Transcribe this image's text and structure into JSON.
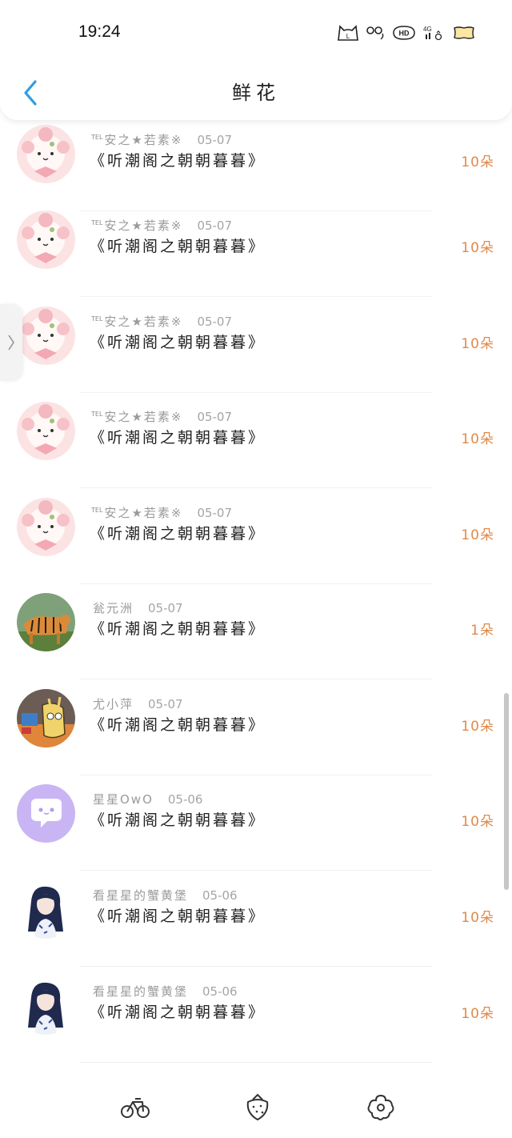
{
  "status_bar": {
    "time": "19:24"
  },
  "header": {
    "title": "鲜花",
    "back_icon": "chevron-left-icon",
    "accent": "#2f9be8"
  },
  "rows": [
    {
      "user": "安之★若素※",
      "tel": "TEL",
      "date": "05-07",
      "title": "《听潮阁之朝朝暮暮》",
      "count": "10朵",
      "avatar": "sheep"
    },
    {
      "user": "安之★若素※",
      "tel": "TEL",
      "date": "05-07",
      "title": "《听潮阁之朝朝暮暮》",
      "count": "10朵",
      "avatar": "sheep"
    },
    {
      "user": "安之★若素※",
      "tel": "TEL",
      "date": "05-07",
      "title": "《听潮阁之朝朝暮暮》",
      "count": "10朵",
      "avatar": "sheep"
    },
    {
      "user": "安之★若素※",
      "tel": "TEL",
      "date": "05-07",
      "title": "《听潮阁之朝朝暮暮》",
      "count": "10朵",
      "avatar": "sheep"
    },
    {
      "user": "安之★若素※",
      "tel": "TEL",
      "date": "05-07",
      "title": "《听潮阁之朝朝暮暮》",
      "count": "10朵",
      "avatar": "sheep"
    },
    {
      "user": "瓮元洲",
      "tel": "",
      "date": "05-07",
      "title": "《听潮阁之朝朝暮暮》",
      "count": "1朵",
      "avatar": "tiger"
    },
    {
      "user": "尤小萍",
      "tel": "",
      "date": "05-07",
      "title": "《听潮阁之朝朝暮暮》",
      "count": "10朵",
      "avatar": "cartoon"
    },
    {
      "user": "星星OwO",
      "tel": "",
      "date": "05-06",
      "title": "《听潮阁之朝朝暮暮》",
      "count": "10朵",
      "avatar": "chat"
    },
    {
      "user": "看星星的蟹黄堡",
      "tel": "",
      "date": "05-06",
      "title": "《听潮阁之朝朝暮暮》",
      "count": "10朵",
      "avatar": "girl"
    },
    {
      "user": "看星星的蟹黄堡",
      "tel": "",
      "date": "05-06",
      "title": "《听潮阁之朝朝暮暮》",
      "count": "10朵",
      "avatar": "girl"
    }
  ],
  "bottom_tabs": [
    {
      "icon": "bicycle-icon"
    },
    {
      "icon": "strawberry-icon"
    },
    {
      "icon": "flower-icon"
    }
  ],
  "colors": {
    "count": "#e0894a",
    "meta": "#9a9a9a"
  }
}
